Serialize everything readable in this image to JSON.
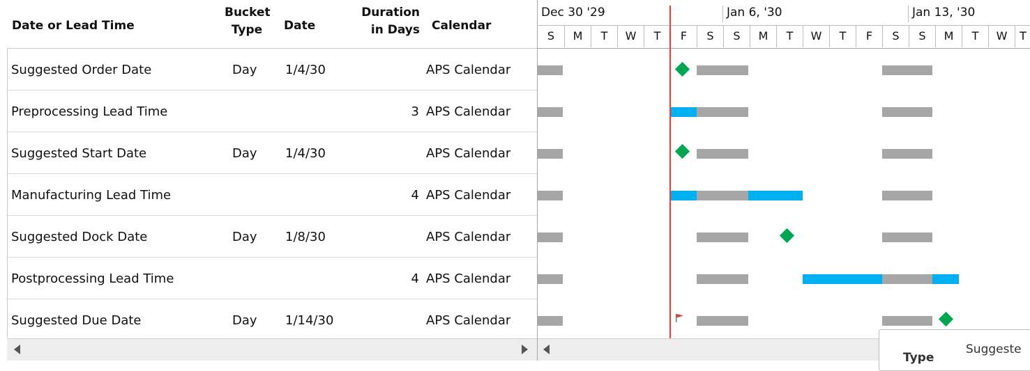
{
  "columns": {
    "name": "Date or Lead Time",
    "bucket_line1": "Bucket",
    "bucket_line2": "Type",
    "date": "Date",
    "duration_line1": "Duration",
    "duration_line2": "in Days",
    "calendar": "Calendar"
  },
  "rows": [
    {
      "name": "Suggested Order Date",
      "bucket": "Day",
      "date": "1/4/30",
      "duration": "",
      "calendar": "APS Calendar"
    },
    {
      "name": "Preprocessing Lead Time",
      "bucket": "",
      "date": "",
      "duration": "3",
      "calendar": "APS Calendar"
    },
    {
      "name": "Suggested Start Date",
      "bucket": "Day",
      "date": "1/4/30",
      "duration": "",
      "calendar": "APS Calendar"
    },
    {
      "name": "Manufacturing Lead Time",
      "bucket": "",
      "date": "",
      "duration": "4",
      "calendar": "APS Calendar"
    },
    {
      "name": "Suggested Dock Date",
      "bucket": "Day",
      "date": "1/8/30",
      "duration": "",
      "calendar": "APS Calendar"
    },
    {
      "name": "Postprocessing Lead Time",
      "bucket": "",
      "date": "",
      "duration": "4",
      "calendar": "APS Calendar"
    },
    {
      "name": "Suggested Due Date",
      "bucket": "Day",
      "date": "1/14/30",
      "duration": "",
      "calendar": "APS Calendar"
    }
  ],
  "timescale": {
    "weeks": [
      "Dec 30 '29",
      "Jan 6, '30",
      "Jan 13, '30"
    ],
    "days": [
      "S",
      "M",
      "T",
      "W",
      "T",
      "F",
      "S",
      "S",
      "M",
      "T",
      "W",
      "T",
      "F",
      "S",
      "S",
      "M",
      "T",
      "W",
      "T"
    ]
  },
  "tooltip": {
    "label": "Type",
    "value": "Suggeste"
  },
  "colors": {
    "nonworking_bar": "#a6a6a6",
    "lead_time_bar": "#00b0f0",
    "milestone": "#00a651",
    "current_date_line": "#ee3a3a"
  },
  "icons": {
    "milestone": "diamond-icon",
    "flag": "flag-icon",
    "scroll_left": "arrow-left-icon",
    "scroll_right": "arrow-right-icon"
  }
}
